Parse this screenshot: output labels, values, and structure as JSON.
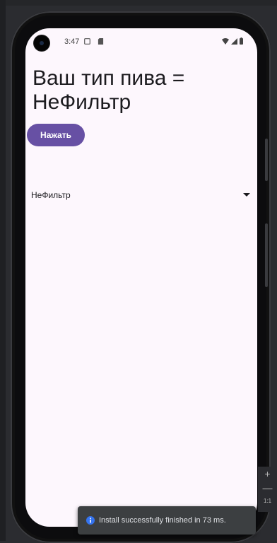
{
  "statusbar": {
    "time": "3:47",
    "icons_left": [
      "screen-cast-icon",
      "sd-card-icon"
    ],
    "icons_right": [
      "wifi-icon",
      "signal-icon",
      "battery-icon"
    ]
  },
  "app": {
    "title": "Ваш тип пива = НеФильтр",
    "button_label": "Нажать",
    "spinner_value": "НеФильтр",
    "accent_color": "#6750a4",
    "background_color": "#fdf7fd"
  },
  "toast": {
    "message": "Install successfully finished in 73 ms."
  },
  "zoom_controls": {
    "zoom_in": "+",
    "zoom_out": "—",
    "ratio": "1:1"
  }
}
